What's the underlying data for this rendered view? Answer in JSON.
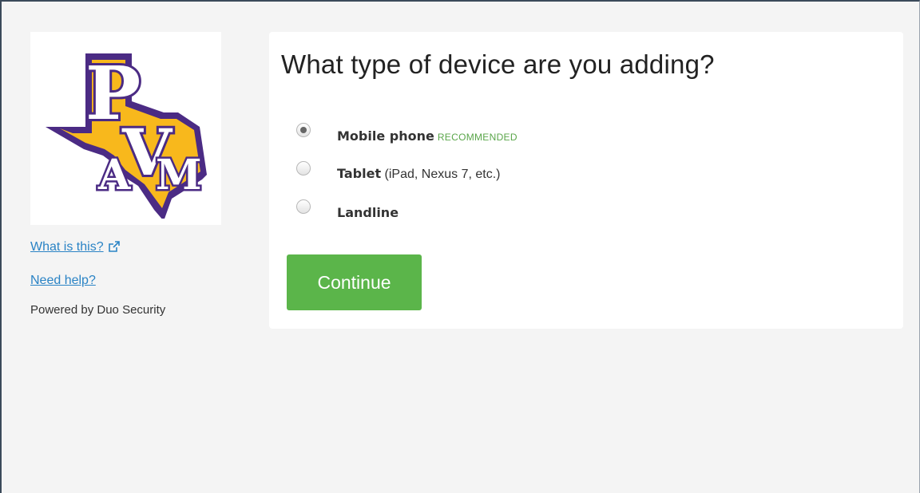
{
  "sidebar": {
    "logo_alt": "PVAM",
    "links": [
      {
        "label": "What is this?"
      },
      {
        "label": "Need help?"
      }
    ],
    "powered_by": "Powered by Duo Security"
  },
  "main": {
    "title": "What type of device are you adding?",
    "options": [
      {
        "bold": "Mobile phone",
        "note": "",
        "badge": "RECOMMENDED",
        "selected": true
      },
      {
        "bold": "Tablet",
        "note": " (iPad, Nexus 7, etc.)",
        "badge": "",
        "selected": false
      },
      {
        "bold": "Landline",
        "note": "",
        "badge": "",
        "selected": false
      }
    ],
    "continue_label": "Continue"
  },
  "colors": {
    "accent": "#5bb54a",
    "link": "#2a83c5",
    "logo_purple": "#4b2b84",
    "logo_gold": "#f8b81c"
  }
}
